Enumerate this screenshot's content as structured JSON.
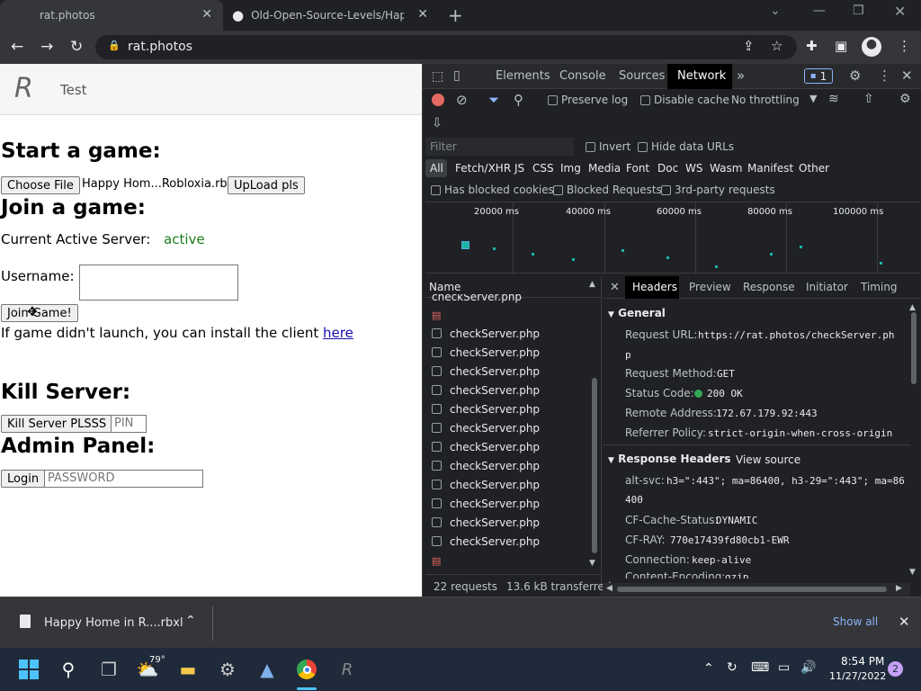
{
  "browser": {
    "tabs": [
      {
        "title": "rat.photos"
      },
      {
        "title": "Old-Open-Source-Levels/Happy"
      }
    ],
    "url": "rat.photos"
  },
  "page": {
    "nav_item": "Test",
    "start_heading": "Start a game:",
    "choose_file_label": "Choose File",
    "chosen_file": "Happy Hom...Robloxia.rbxl",
    "upload_label": "UpLoad pls",
    "join_heading": "Join a game:",
    "server_label": "Current Active Server:",
    "server_status": "active",
    "username_label": "Username:",
    "username_value": "",
    "join_button": "Join Game!",
    "install_text": "If game didn't launch, you can install the client",
    "install_link": "here",
    "kill_heading": "Kill Server:",
    "kill_button": "Kill Server PLSSS",
    "pin_placeholder": "PIN",
    "admin_heading": "Admin Panel:",
    "login_button": "Login",
    "password_placeholder": "PASSWORD"
  },
  "devtools": {
    "tabs": [
      "Elements",
      "Console",
      "Sources",
      "Network"
    ],
    "issues_count": "1",
    "preserve_log": "Preserve log",
    "disable_cache": "Disable cache",
    "throttling": "No throttling",
    "filter_placeholder": "Filter",
    "invert": "Invert",
    "hide_data_urls": "Hide data URLs",
    "type_filters": [
      "All",
      "Fetch/XHR",
      "JS",
      "CSS",
      "Img",
      "Media",
      "Font",
      "Doc",
      "WS",
      "Wasm",
      "Manifest",
      "Other"
    ],
    "has_blocked_cookies": "Has blocked cookies",
    "blocked_requests": "Blocked Requests",
    "third_party": "3rd-party requests",
    "timeline_labels": [
      "20000 ms",
      "40000 ms",
      "60000 ms",
      "80000 ms",
      "100000 ms"
    ],
    "name_header": "Name",
    "partial_top_row": "checkServer.php",
    "requests": [
      "checkServer.php",
      "checkServer.php",
      "checkServer.php",
      "checkServer.php",
      "checkServer.php",
      "checkServer.php",
      "checkServer.php",
      "checkServer.php",
      "checkServer.php",
      "checkServer.php",
      "checkServer.php",
      "checkServer.php"
    ],
    "summary_requests": "22 requests",
    "summary_transferred": "13.6 kB transferred",
    "detail_tabs": [
      "Headers",
      "Preview",
      "Response",
      "Initiator",
      "Timing"
    ],
    "general_title": "General",
    "request_url_label": "Request URL:",
    "request_url_value": "https://rat.photos/checkServer.ph",
    "request_url_value_2": "p",
    "request_method_label": "Request Method:",
    "request_method_value": "GET",
    "status_code_label": "Status Code:",
    "status_code_value": "200 OK",
    "remote_address_label": "Remote Address:",
    "remote_address_value": "172.67.179.92:443",
    "referrer_policy_label": "Referrer Policy:",
    "referrer_policy_value": "strict-origin-when-cross-origin",
    "response_headers_title": "Response Headers",
    "view_source": "View source",
    "alt_svc_label": "alt-svc:",
    "alt_svc_value": "h3=\":443\"; ma=86400, h3-29=\":443\"; ma=86",
    "alt_svc_value_2": "400",
    "cf_cache_label": "CF-Cache-Status:",
    "cf_cache_value": "DYNAMIC",
    "cf_ray_label": "CF-RAY:",
    "cf_ray_value": "770e17439fd80cb1-EWR",
    "connection_label": "Connection:",
    "connection_value": "keep-alive",
    "content_encoding_label": "Content-Encoding:",
    "content_encoding_value": "gzip"
  },
  "download_bar": {
    "file": "Happy Home in R....rbxl",
    "show_all": "Show all"
  },
  "taskbar": {
    "weather": "79°",
    "time": "8:54 PM",
    "date": "11/27/2022",
    "notification_count": "2"
  },
  "colors": {
    "active_status": "#1a7f1a",
    "record": "#e46962",
    "accent_blue": "#8ab4f8",
    "status_ok": "#34a853"
  },
  "icons": [
    "back-icon",
    "forward-icon",
    "reload-icon",
    "lock-icon",
    "share-icon",
    "star-icon",
    "extensions-icon",
    "sidepanel-icon",
    "profile-icon",
    "menu-icon"
  ]
}
